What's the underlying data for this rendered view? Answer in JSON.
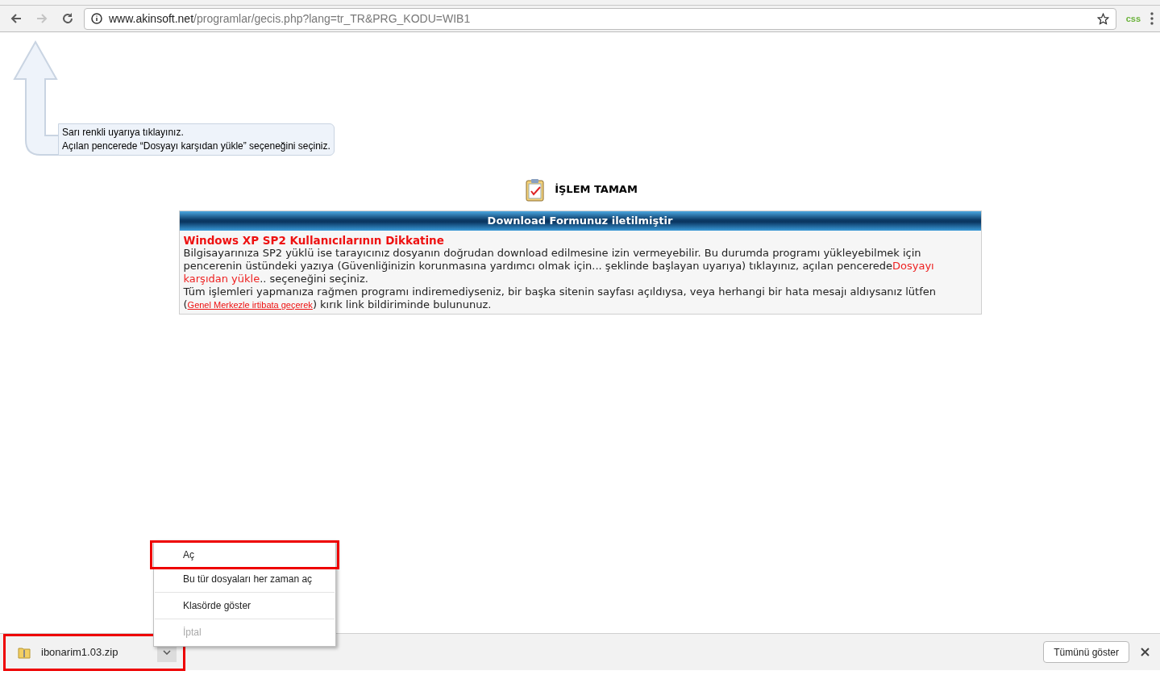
{
  "address_bar": {
    "host": "www.akinsoft.net",
    "path": "/programlar/gecis.php?lang=tr_TR&PRG_KODU=WIB1"
  },
  "extension": {
    "label": "css"
  },
  "hint": {
    "lines": [
      "Sarı renkli uyarıya tıklayınız.",
      "Açılan pencerede “Dosyayı karşıdan yükle” seçeneğini seçiniz."
    ]
  },
  "status": {
    "title": "İŞLEM TAMAM"
  },
  "panel": {
    "header": "Download Formunuz iletilmiştir",
    "title": "Windows XP SP2 Kullanıcılarının Dikkatine",
    "paragraph_1": {
      "before": "Bilgisayarınıza SP2 yüklü ise tarayıcınız dosyanın doğrudan download edilmesine izin vermeyebilir. Bu durumda programı yükleyebilmek için pencerenin üstündeki yazıya (Güvenliğinizin korunmasına yardımcı olmak için... şeklinde başlayan uyarıya) tıklayınız, açılan pencerede",
      "highlight": "Dosyayı karşıdan yükle",
      "after": ".. seçeneğini seçiniz."
    },
    "paragraph_2": {
      "before": "Tüm işlemleri yapmanıza rağmen programı indiremediyseniz, bir başka sitenin sayfası açıldıysa, veya herhangi bir hata mesajı aldıysanız lütfen (",
      "link": "Genel Merkezle irtibata geçerek",
      "after": ") kırık link bildiriminde bulununuz."
    }
  },
  "context_menu": {
    "items": [
      {
        "label": "Aç",
        "highlighted": true,
        "disabled": false,
        "separator_before": false
      },
      {
        "label": "Bu tür dosyaları her zaman aç",
        "highlighted": false,
        "disabled": false,
        "separator_before": false
      },
      {
        "label": "Klasörde göster",
        "highlighted": false,
        "disabled": false,
        "separator_before": true
      },
      {
        "label": "İptal",
        "highlighted": false,
        "disabled": true,
        "separator_before": true
      }
    ]
  },
  "download_bar": {
    "item": {
      "filename": "ibonarim1.03.zip",
      "highlighted": true
    },
    "show_all": "Tümünü göster"
  }
}
